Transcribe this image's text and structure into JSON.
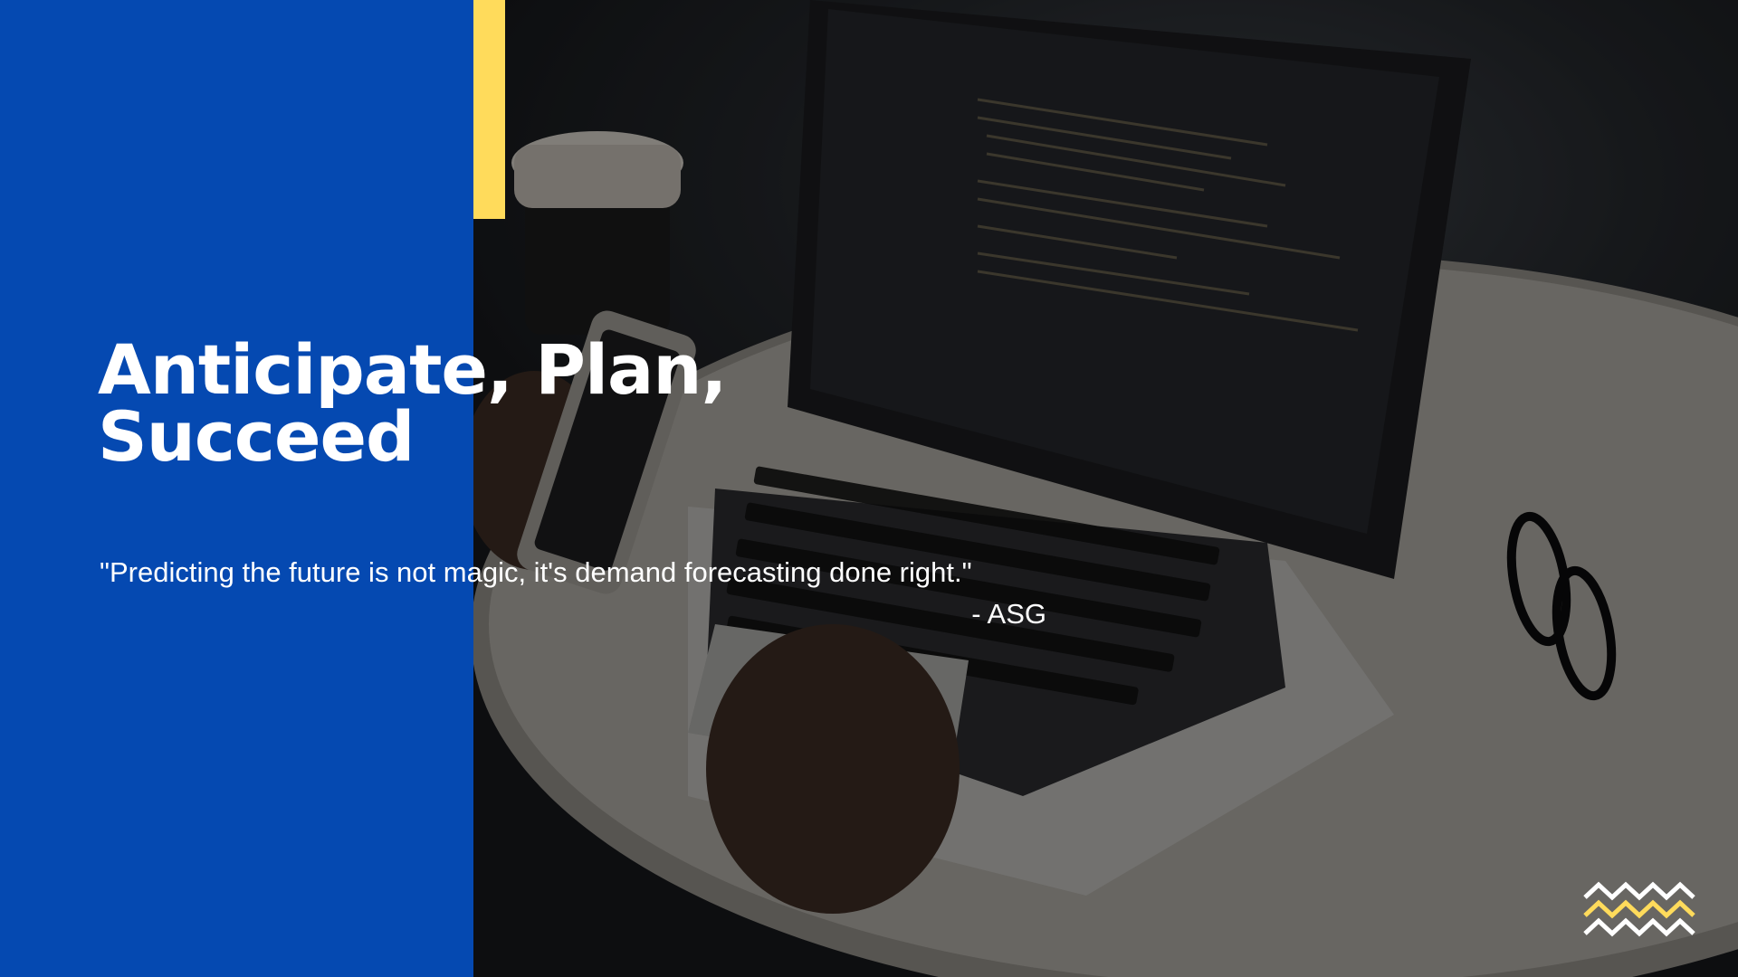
{
  "slide": {
    "title_line1": "Anticipate, Plan,",
    "title_line2": "Succeed",
    "quote": "\"Predicting the future is not magic, it's demand forecasting done right.\"",
    "quote_author": "- ASG"
  },
  "colors": {
    "panel_blue": "#0549b1",
    "accent_yellow": "#ffdb5b",
    "text_white": "#ffffff"
  },
  "background_image": "person-using-laptop-and-phone-on-round-table",
  "logo_icon": "zigzag-waves-icon"
}
